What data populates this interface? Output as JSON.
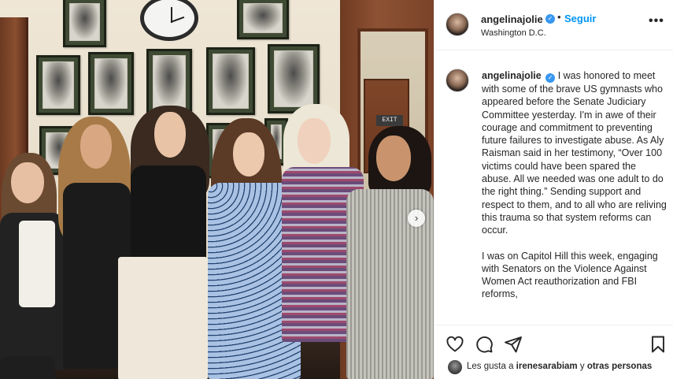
{
  "post": {
    "username": "angelinajolie",
    "verified_mark": "✓",
    "separator": "•",
    "follow_label": "Seguir",
    "location": "Washington D.C.",
    "more_label": "•••",
    "photo_exit_sign": "EXIT",
    "slider_arrow": "›"
  },
  "caption": {
    "username": "angelinajolie",
    "paragraph_1": "I was honored to meet with some of the brave US gymnasts who appeared before the Senate Judiciary Committee yesterday. I'm in awe of their courage and commitment to preventing future failures to investigate abuse. As Aly Raisman said in her testimony, “Over 100 victims could have been spared the abuse. All we needed was one adult to do the right thing.” Sending support and respect to them, and to all who are reliving this trauma so that system reforms can occur.",
    "paragraph_2": "I was on Capitol Hill this week, engaging with Senators on the Violence Against Women Act reauthorization and FBI reforms,"
  },
  "actions": {
    "like_icon": "heart-icon",
    "comment_icon": "comment-icon",
    "share_icon": "paper-plane-icon",
    "save_icon": "bookmark-icon"
  },
  "likes": {
    "prefix": "Les gusta a",
    "user": "irenesarabiam",
    "connector": "y",
    "others": "otras personas"
  },
  "colors": {
    "link_blue": "#0095f6",
    "verified_blue": "#3897f0",
    "text": "#262626",
    "border": "#efefef"
  }
}
